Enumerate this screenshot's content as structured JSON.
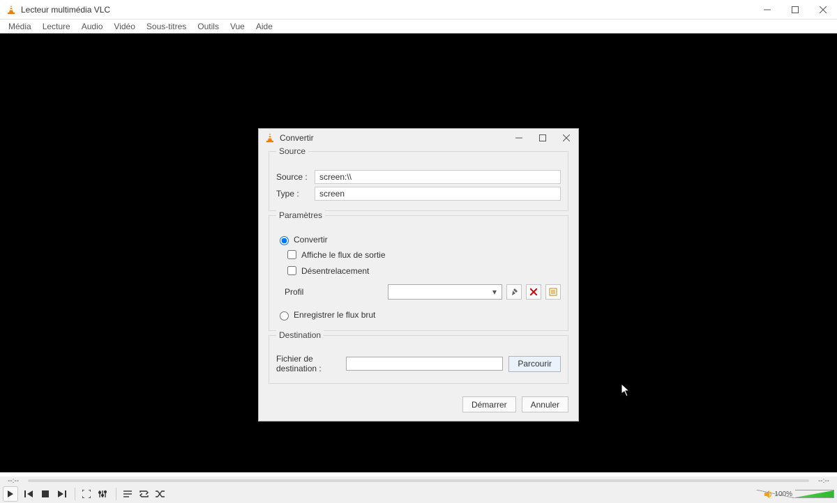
{
  "app": {
    "title": "Lecteur multimédia VLC"
  },
  "menu": {
    "items": [
      "Média",
      "Lecture",
      "Audio",
      "Vidéo",
      "Sous-titres",
      "Outils",
      "Vue",
      "Aide"
    ]
  },
  "seek": {
    "elapsed": "--:--",
    "remaining": "--:--"
  },
  "volume": {
    "percent_text": "100%"
  },
  "dialog": {
    "title": "Convertir",
    "source_group": {
      "legend": "Source",
      "source_label": "Source :",
      "source_value": "screen:\\\\",
      "type_label": "Type :",
      "type_value": "screen"
    },
    "params_group": {
      "legend": "Paramètres",
      "radio_convert": "Convertir",
      "check_display": "Affiche le flux de sortie",
      "check_deint": "Désentrelacement",
      "profile_label": "Profil",
      "profile_value": "",
      "radio_raw": "Enregistrer le flux brut"
    },
    "dest_group": {
      "legend": "Destination",
      "dest_label": "Fichier de destination :",
      "dest_value": "",
      "browse": "Parcourir"
    },
    "footer": {
      "start": "Démarrer",
      "cancel": "Annuler"
    }
  }
}
